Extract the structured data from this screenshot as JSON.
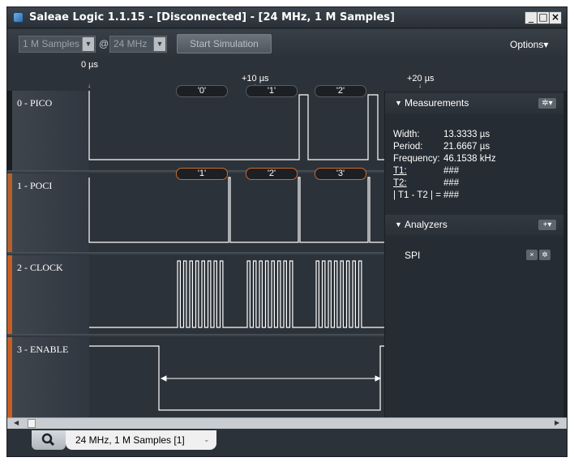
{
  "window": {
    "title": "Saleae Logic 1.1.15 - [Disconnected] - [24 MHz, 1 M Samples]",
    "controls": {
      "minimize": "_",
      "maximize": "□",
      "close": "×"
    }
  },
  "toolbar": {
    "samples_value": "1 M Samples",
    "at_label": "@",
    "rate_value": "24 MHz",
    "start_label": "Start Simulation",
    "options_label": "Options▾"
  },
  "timeline": {
    "ticks": [
      "0 µs",
      "+10 µs",
      "+20 µs"
    ]
  },
  "channels": [
    {
      "label": "0 - PICO",
      "color": "#1a1c1f"
    },
    {
      "label": "1 - POCI",
      "color": "#b5602c"
    },
    {
      "label": "2 - CLOCK",
      "color": "#c95e22"
    },
    {
      "label": "3 - ENABLE",
      "color": "#c95e22"
    }
  ],
  "decodes": {
    "pico": [
      "'0'",
      "'1'",
      "'2'"
    ],
    "poci": [
      "'1'",
      "'2'",
      "'3'"
    ]
  },
  "measurements": {
    "title": "Measurements",
    "rows": [
      {
        "key": "Width:",
        "value": "13.3333 µs"
      },
      {
        "key": "Period:",
        "value": "21.6667 µs"
      },
      {
        "key": "Frequency:",
        "value": "46.1538 kHz"
      },
      {
        "key": "T1:",
        "value": "###"
      },
      {
        "key": "T2:",
        "value": "###"
      },
      {
        "key": "| T1 - T2 | =",
        "value": "###"
      }
    ]
  },
  "analyzers": {
    "title": "Analyzers",
    "items": [
      {
        "name": "SPI"
      }
    ]
  },
  "tabs": {
    "session_label": "24 MHz, 1 M Samples [1]"
  },
  "colors": {
    "background": "#2c3239",
    "trace": "#ffffff",
    "accent": "#c95e22"
  }
}
